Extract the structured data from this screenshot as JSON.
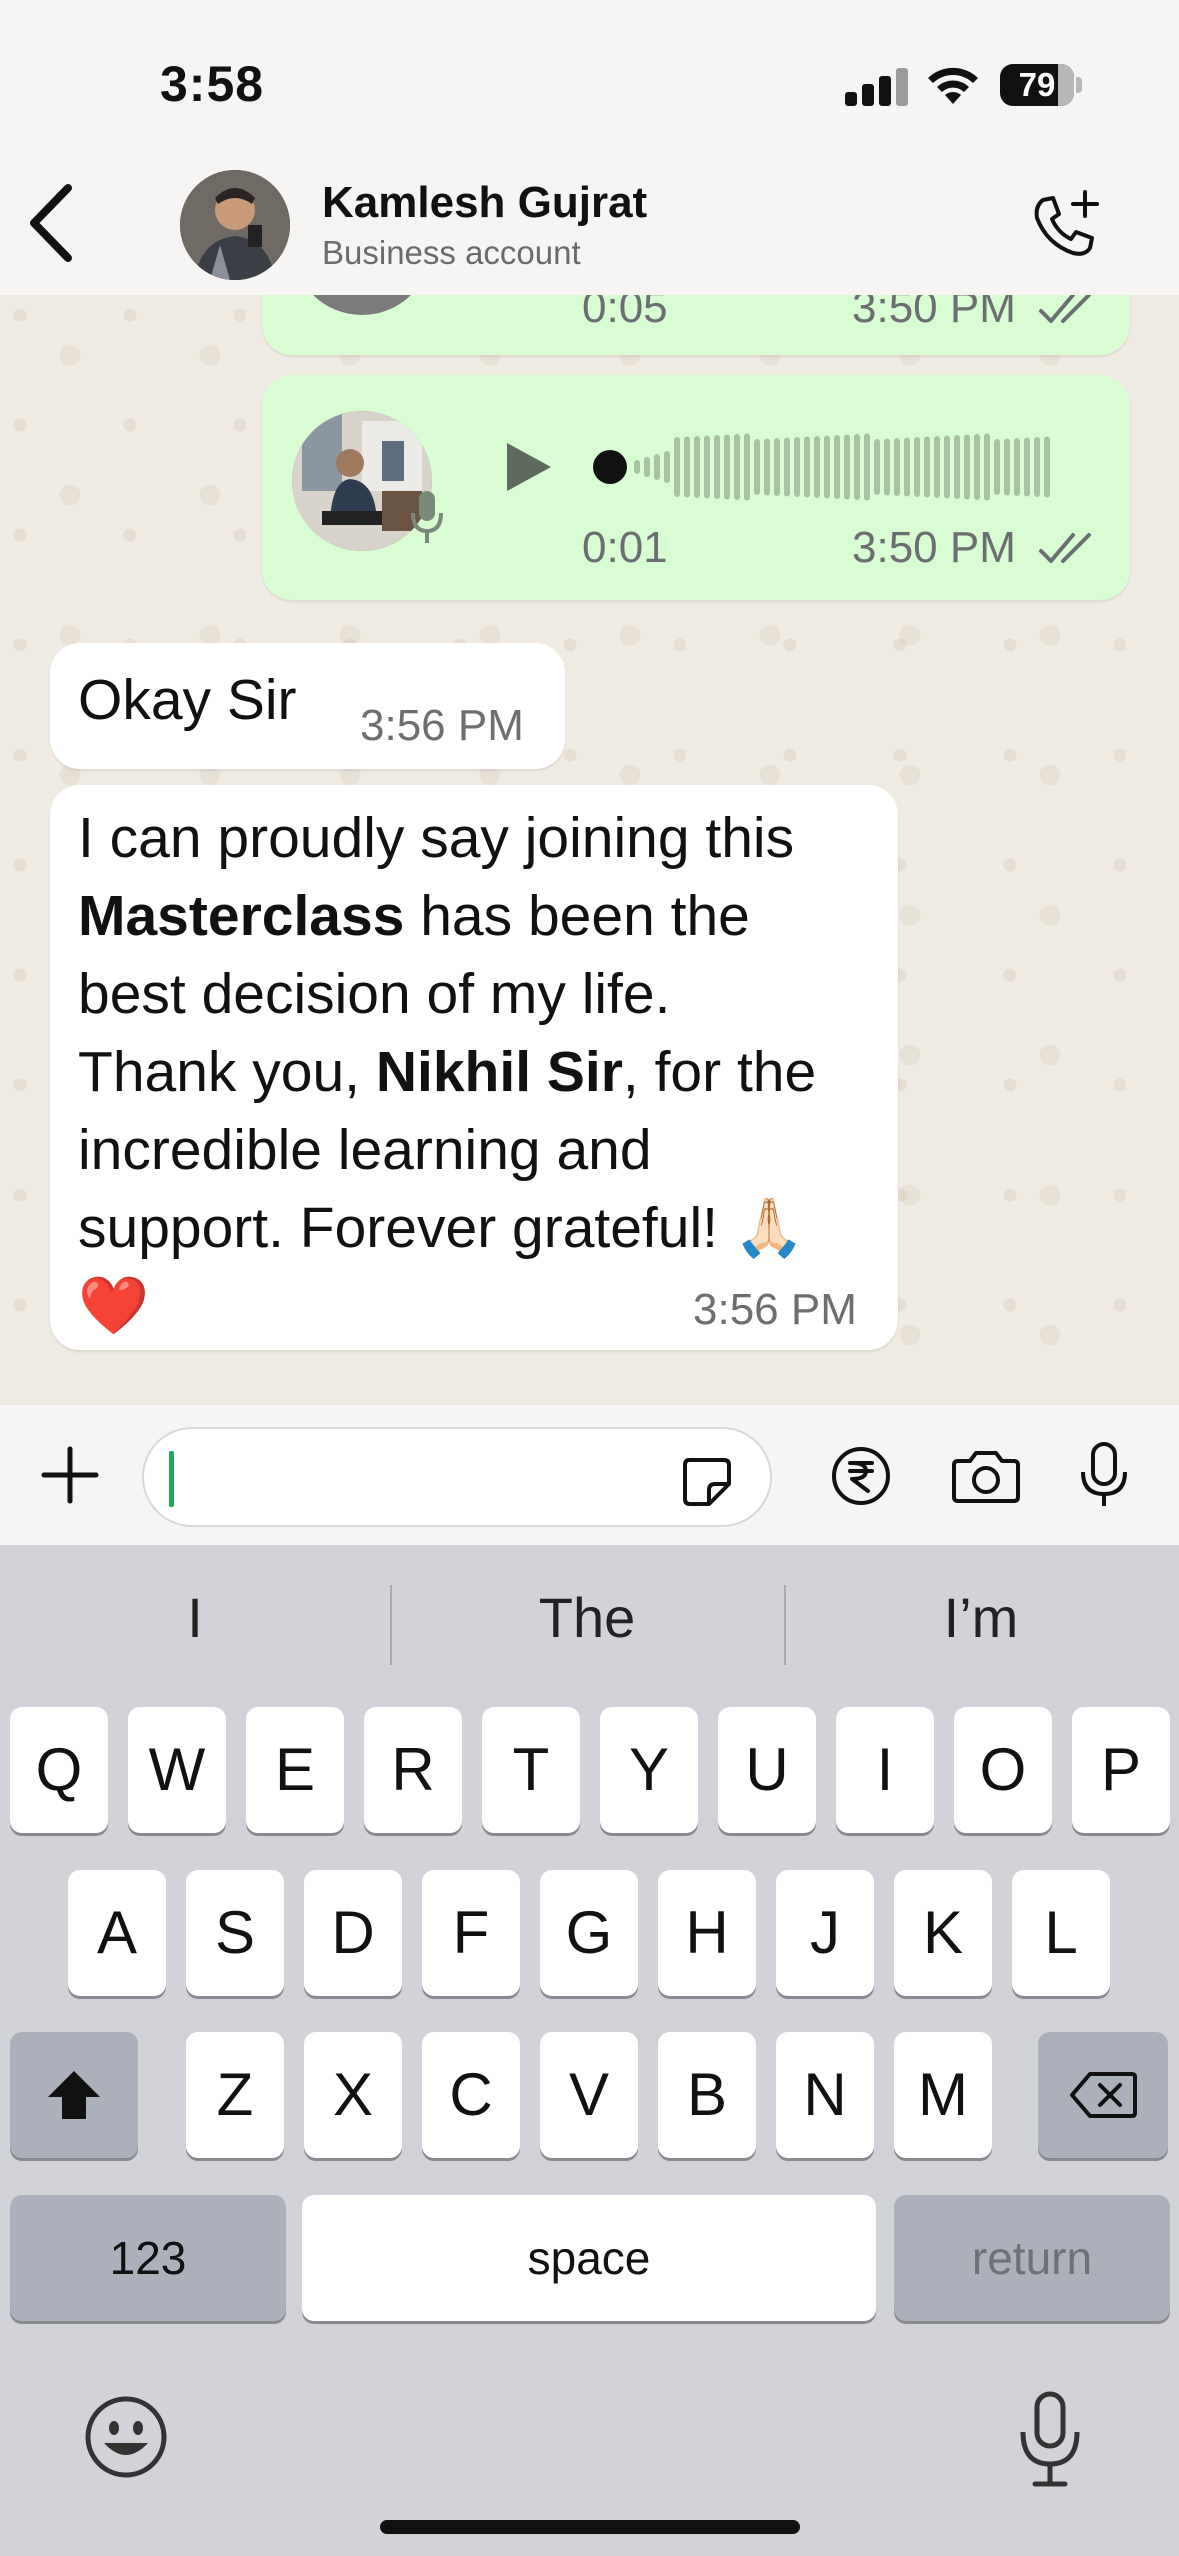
{
  "status_bar": {
    "time": "3:58",
    "battery": "79"
  },
  "header": {
    "contact_name": "Kamlesh Gujrat",
    "subtitle": "Business account"
  },
  "messages": [
    {
      "type": "voice",
      "direction": "outgoing",
      "duration": "0:05",
      "time": "3:50 PM",
      "status": "read"
    },
    {
      "type": "voice",
      "direction": "outgoing",
      "duration": "0:01",
      "time": "3:50 PM",
      "status": "read"
    },
    {
      "type": "text",
      "direction": "incoming",
      "text": "Okay Sir",
      "time": "3:56 PM"
    },
    {
      "type": "text",
      "direction": "incoming",
      "time": "3:56 PM",
      "parts": {
        "p1": "I can proudly say joining this",
        "bold1": "Masterclass",
        "p2": " has been the",
        "p3": "best decision of my life.",
        "p4": "Thank you, ",
        "bold2": "Nikhil Sir",
        "p5": ", for the",
        "p6": "incredible learning and",
        "p7": "support. Forever grateful! ",
        "emoji1": "🙏🏻",
        "emoji2": "❤️"
      }
    }
  ],
  "input": {
    "value": ""
  },
  "keyboard": {
    "suggestions": [
      "I",
      "The",
      "I’m"
    ],
    "row1": [
      "Q",
      "W",
      "E",
      "R",
      "T",
      "Y",
      "U",
      "I",
      "O",
      "P"
    ],
    "row2": [
      "A",
      "S",
      "D",
      "F",
      "G",
      "H",
      "J",
      "K",
      "L"
    ],
    "row3": [
      "Z",
      "X",
      "C",
      "V",
      "B",
      "N",
      "M"
    ],
    "numbers_label": "123",
    "space_label": "space",
    "return_label": "return"
  },
  "colors": {
    "outgoing_bubble": "#d9fdd3",
    "incoming_bubble": "#ffffff",
    "read_ticks": "#6b6f72",
    "caret": "#1fa855"
  },
  "icons": [
    "back-chevron-icon",
    "add-call-icon",
    "play-icon",
    "microphone-icon",
    "plus-icon",
    "sticker-icon",
    "rupee-icon",
    "camera-icon",
    "emoji-icon",
    "shift-icon",
    "backspace-icon"
  ]
}
